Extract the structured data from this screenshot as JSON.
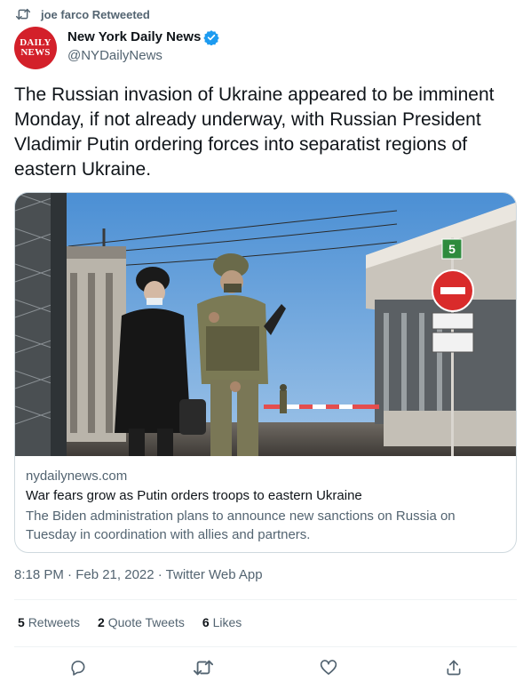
{
  "retweet_context": {
    "text": "joe farco Retweeted",
    "icon": "retweet-icon"
  },
  "author": {
    "name": "New York Daily News",
    "handle": "@NYDailyNews",
    "avatar_line1": "DAILY",
    "avatar_line2": "NEWS",
    "avatar_color": "#d3202a",
    "verified_color": "#1d9bf0"
  },
  "tweet": {
    "text": "The Russian invasion of Ukraine appeared to be imminent Monday, if not already underway, with Russian President Vladimir Putin ordering forces into separatist regions of eastern Ukraine."
  },
  "card": {
    "image_sign_number": "5",
    "domain": "nydailynews.com",
    "title": "War fears grow as Putin orders troops to eastern Ukraine",
    "description": "The Biden administration plans to announce new sanctions on Russia on Tuesday in coordination with allies and partners."
  },
  "meta": {
    "timestamp": "8:18 PM · Feb 21, 2022 · Twitter Web App"
  },
  "stats": {
    "retweets_count": "5",
    "retweets_label": "Retweets",
    "quote_count": "2",
    "quote_label": "Quote Tweets",
    "likes_count": "6",
    "likes_label": "Likes"
  },
  "actions": [
    "reply-icon",
    "retweet-icon",
    "like-icon",
    "share-icon"
  ],
  "colors": {
    "text_primary": "#0f1419",
    "text_secondary": "#536471",
    "border": "#cfd9de",
    "accent": "#1d9bf0"
  }
}
